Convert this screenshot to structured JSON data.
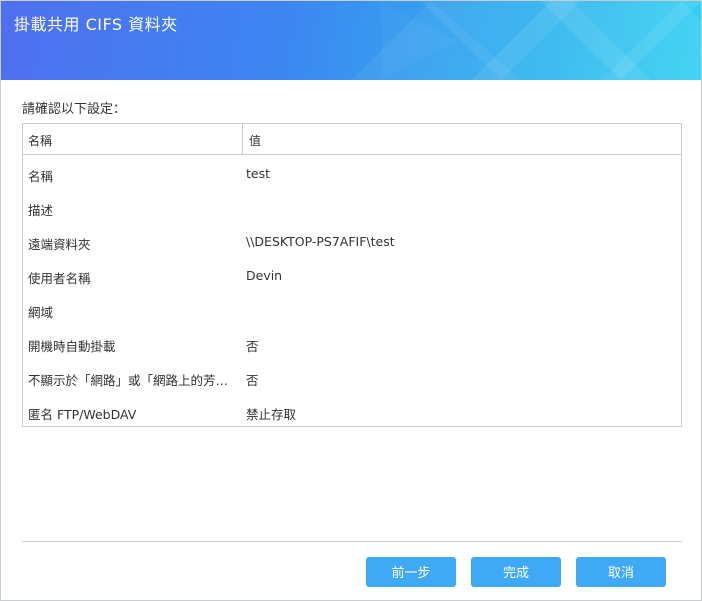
{
  "dialog": {
    "title": "掛載共用 CIFS 資料夾",
    "prompt": "請確認以下設定：",
    "columns": {
      "name": "名稱",
      "value": "值"
    },
    "rows": [
      {
        "name": "名稱",
        "value": "test"
      },
      {
        "name": "描述",
        "value": ""
      },
      {
        "name": "遠端資料夾",
        "value": "\\\\DESKTOP-PS7AFIF\\test"
      },
      {
        "name": "使用者名稱",
        "value": "Devin"
      },
      {
        "name": "網域",
        "value": ""
      },
      {
        "name": "開機時自動掛載",
        "value": "否"
      },
      {
        "name": "不顯示於「網路」或「網路上的芳…",
        "value": "否"
      },
      {
        "name": "匿名 FTP/WebDAV",
        "value": "禁止存取"
      }
    ],
    "buttons": {
      "back": "前一步",
      "finish": "完成",
      "cancel": "取消"
    }
  },
  "colors": {
    "header_start": "#4f6ff0",
    "header_end": "#35d1f2",
    "button": "#3fa9f5"
  }
}
